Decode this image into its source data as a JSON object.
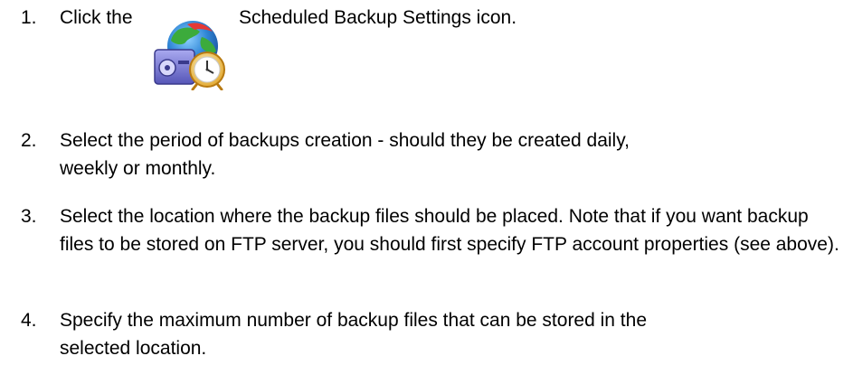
{
  "steps": [
    {
      "number": "1.",
      "text_before": "Click the",
      "icon": "scheduled-backup-settings-icon",
      "text_after": "Scheduled Backup Settings icon."
    },
    {
      "number": "2.",
      "text": "Select the period of backups creation - should they be created daily, weekly or monthly."
    },
    {
      "number": "3.",
      "text": "Select the location where the backup files should be placed. Note that if you want backup files to be stored on FTP server, you should first specify FTP account properties (see above)."
    },
    {
      "number": "4.",
      "text": "Specify the maximum number of backup files that can be stored in the selected location."
    }
  ]
}
